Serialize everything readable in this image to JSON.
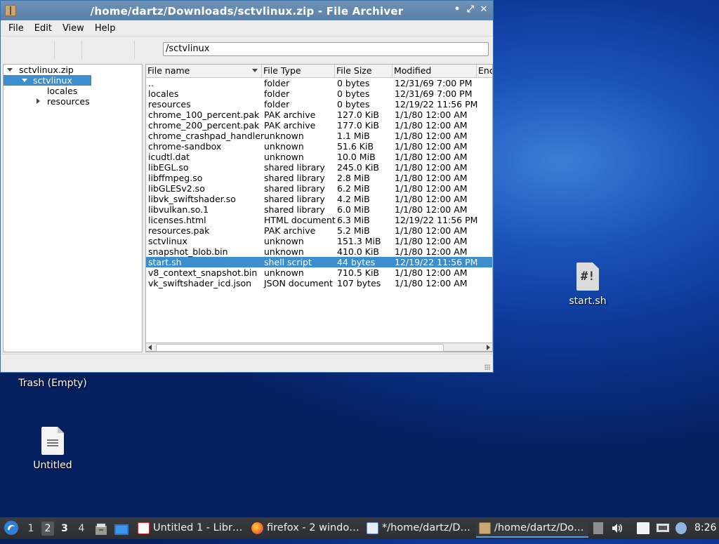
{
  "window": {
    "title": "/home/dartz/Downloads/sctvlinux.zip - File Archiver",
    "menu": [
      "File",
      "Edit",
      "View",
      "Help"
    ],
    "location": "/sctvlinux"
  },
  "tree": {
    "root": "sctvlinux.zip",
    "selected": "sctvlinux",
    "children": [
      "locales",
      "resources"
    ]
  },
  "list": {
    "columns": [
      "File name",
      "File Type",
      "File Size",
      "Modified",
      "Enc"
    ],
    "rows": [
      {
        "name": "..",
        "type": "folder",
        "size": "0 bytes",
        "modified": "12/31/69 7:00 PM"
      },
      {
        "name": "locales",
        "type": "folder",
        "size": "0 bytes",
        "modified": "12/31/69 7:00 PM"
      },
      {
        "name": "resources",
        "type": "folder",
        "size": "0 bytes",
        "modified": "12/19/22 11:56 PM"
      },
      {
        "name": "chrome_100_percent.pak",
        "type": "PAK archive",
        "size": "127.0 KiB",
        "modified": "1/1/80 12:00 AM"
      },
      {
        "name": "chrome_200_percent.pak",
        "type": "PAK archive",
        "size": "177.0 KiB",
        "modified": "1/1/80 12:00 AM"
      },
      {
        "name": "chrome_crashpad_handler",
        "type": "unknown",
        "size": "1.1 MiB",
        "modified": "1/1/80 12:00 AM"
      },
      {
        "name": "chrome-sandbox",
        "type": "unknown",
        "size": "51.6 KiB",
        "modified": "1/1/80 12:00 AM"
      },
      {
        "name": "icudtl.dat",
        "type": "unknown",
        "size": "10.0 MiB",
        "modified": "1/1/80 12:00 AM"
      },
      {
        "name": "libEGL.so",
        "type": "shared library",
        "size": "245.0 KiB",
        "modified": "1/1/80 12:00 AM"
      },
      {
        "name": "libffmpeg.so",
        "type": "shared library",
        "size": "2.8 MiB",
        "modified": "1/1/80 12:00 AM"
      },
      {
        "name": "libGLESv2.so",
        "type": "shared library",
        "size": "6.2 MiB",
        "modified": "1/1/80 12:00 AM"
      },
      {
        "name": "libvk_swiftshader.so",
        "type": "shared library",
        "size": "4.2 MiB",
        "modified": "1/1/80 12:00 AM"
      },
      {
        "name": "libvulkan.so.1",
        "type": "shared library",
        "size": "6.0 MiB",
        "modified": "1/1/80 12:00 AM"
      },
      {
        "name": "licenses.html",
        "type": "HTML document",
        "size": "6.3 MiB",
        "modified": "12/19/22 11:56 PM"
      },
      {
        "name": "resources.pak",
        "type": "PAK archive",
        "size": "5.2 MiB",
        "modified": "1/1/80 12:00 AM"
      },
      {
        "name": "sctvlinux",
        "type": "unknown",
        "size": "151.3 MiB",
        "modified": "1/1/80 12:00 AM"
      },
      {
        "name": "snapshot_blob.bin",
        "type": "unknown",
        "size": "410.0 KiB",
        "modified": "1/1/80 12:00 AM"
      },
      {
        "name": "start.sh",
        "type": "shell script",
        "size": "44 bytes",
        "modified": "12/19/22 11:56 PM",
        "selected": true
      },
      {
        "name": "v8_context_snapshot.bin",
        "type": "unknown",
        "size": "710.5 KiB",
        "modified": "1/1/80 12:00 AM"
      },
      {
        "name": "vk_swiftshader_icd.json",
        "type": "JSON document",
        "size": "107 bytes",
        "modified": "1/1/80 12:00 AM"
      }
    ]
  },
  "desktop": {
    "trash_label": "Trash (Empty)",
    "untitled_label": "Untitled",
    "script_label": "start.sh",
    "script_glyph": "#!"
  },
  "taskbar": {
    "workspaces": [
      "1",
      "2",
      "3",
      "4"
    ],
    "tasks": [
      {
        "label": "Untitled 1 - Libr…",
        "icon": "libreoffice-writer-icon"
      },
      {
        "label": "firefox - 2 windo…",
        "icon": "firefox-icon"
      },
      {
        "label": "*/home/dartz/D…",
        "icon": "text-editor-icon"
      },
      {
        "label": "/home/dartz/Do…",
        "icon": "file-archiver-icon"
      }
    ],
    "clock": "8:26"
  },
  "colors": {
    "selection": "#3d8ecf",
    "titlebar": "#5a80a8",
    "taskbar": "#2b2d30"
  }
}
